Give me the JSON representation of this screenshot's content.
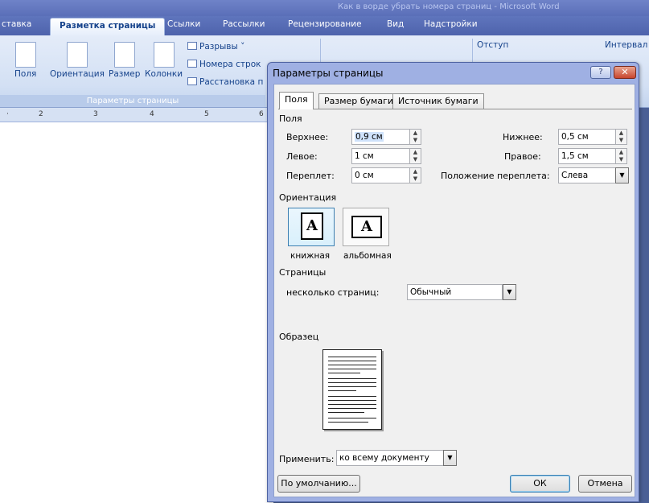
{
  "window": {
    "title": "Как в ворде убрать номера страниц - Microsoft Word"
  },
  "ribbon": {
    "tabs": [
      "ставка",
      "Разметка страницы",
      "Ссылки",
      "Рассылки",
      "Рецензирование",
      "Вид",
      "Надстройки"
    ],
    "active_tab": "Разметка страницы",
    "buttons": {
      "fields": "Поля",
      "orientation": "Ориентация",
      "size": "Размер",
      "columns": "Колонки"
    },
    "small_buttons": {
      "breaks": "Разрывы ˅",
      "line_numbers": "Номера строк",
      "hyphenation": "Расстановка п"
    },
    "group_caption": "Параметры страницы",
    "indent_label": "Отступ",
    "spacing_label": "Интервал"
  },
  "ruler": {
    "marks": [
      "2",
      "3",
      "4",
      "5",
      "6"
    ]
  },
  "dialog": {
    "title": "Параметры страницы",
    "help": "?",
    "close": "✕",
    "tabs": [
      "Поля",
      "Размер бумаги",
      "Источник бумаги"
    ],
    "margins": {
      "section": "Поля",
      "top_label": "Верхнее:",
      "top_value": "0,9 см",
      "bottom_label": "Нижнее:",
      "bottom_value": "0,5 см",
      "left_label": "Левое:",
      "left_value": "1 см",
      "right_label": "Правое:",
      "right_value": "1,5 см",
      "gutter_label": "Переплет:",
      "gutter_value": "0 см",
      "gutter_pos_label": "Положение переплета:",
      "gutter_pos_value": "Слева"
    },
    "orientation": {
      "section": "Ориентация",
      "portrait": "книжная",
      "landscape": "альбомная",
      "glyph": "A"
    },
    "pages": {
      "section": "Страницы",
      "multiple_label": "несколько страниц:",
      "multiple_value": "Обычный"
    },
    "preview": {
      "section": "Образец"
    },
    "apply": {
      "label": "Применить:",
      "value": "ко всему документу"
    },
    "buttons": {
      "default": "По умолчанию...",
      "ok": "ОК",
      "cancel": "Отмена"
    }
  }
}
